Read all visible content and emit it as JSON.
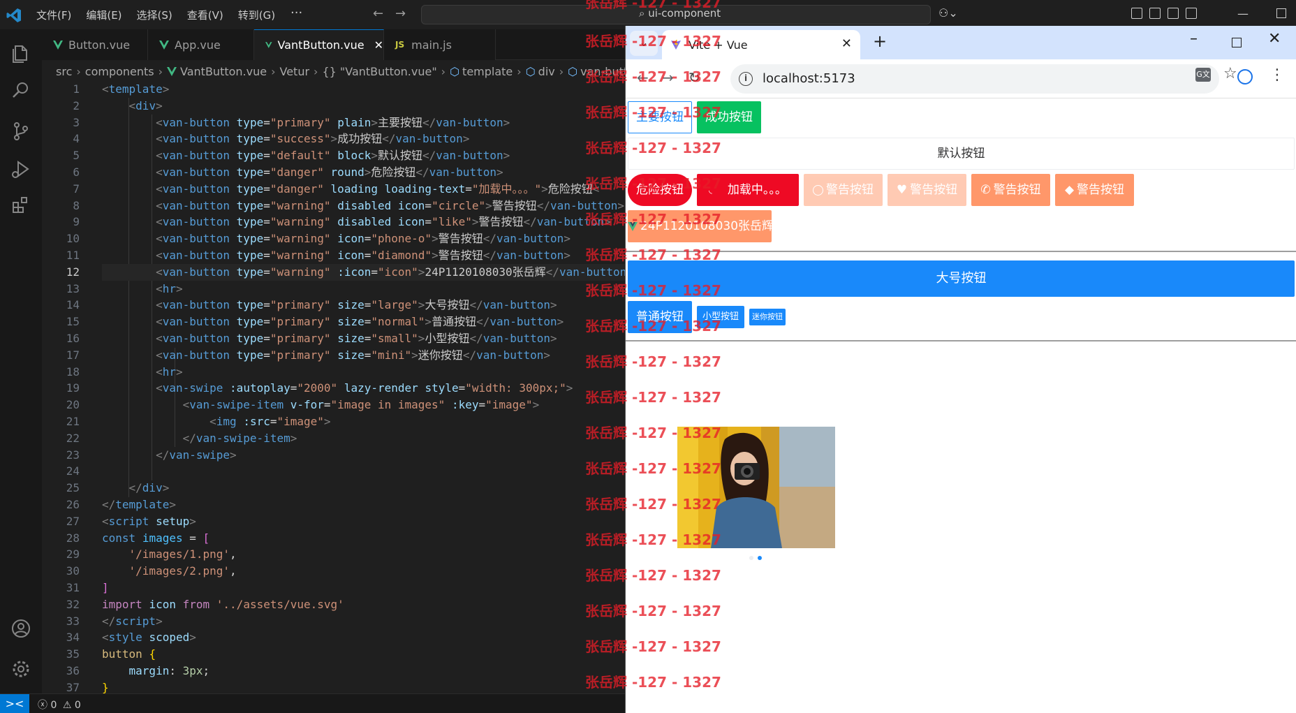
{
  "titlebar": {
    "menu": [
      "文件(F)",
      "编辑(E)",
      "选择(S)",
      "查看(V)",
      "转到(G)"
    ],
    "more": "···",
    "search_text": "ui-component"
  },
  "tabs": [
    {
      "label": "Button.vue",
      "icon": "vue-icon"
    },
    {
      "label": "App.vue",
      "icon": "vue-icon"
    },
    {
      "label": "VantButton.vue",
      "icon": "vue-icon"
    },
    {
      "label": "main.js",
      "icon": "js-icon",
      "prefix": "JS"
    }
  ],
  "breadcrumb": [
    "src",
    "components",
    "VantButton.vue",
    "Vetur",
    "{} \"VantButton.vue\"",
    "template",
    "div",
    "van-button"
  ],
  "editor": {
    "current_line": 12,
    "line_numbers": [
      "1",
      "2",
      "3",
      "4",
      "5",
      "6",
      "7",
      "8",
      "9",
      "10",
      "11",
      "12",
      "13",
      "14",
      "15",
      "16",
      "17",
      "18",
      "19",
      "20",
      "21",
      "22",
      "23",
      "24",
      "25",
      "26",
      "27",
      "28",
      "29",
      "30",
      "31",
      "32",
      "33",
      "34",
      "35",
      "36",
      "37"
    ]
  },
  "statusbar": {
    "remote": "><",
    "errors": "0",
    "warnings": "0"
  },
  "browser": {
    "tab_title": "Vite + Vue",
    "url": "localhost:5173",
    "translate": "G文"
  },
  "page": {
    "btn_primary_plain": "主要按钮",
    "btn_success": "成功按钮",
    "btn_default_block": "默认按钮",
    "btn_danger_round": "危险按钮",
    "btn_loading": "加载中。。。",
    "btn_warning_circle": "警告按钮",
    "btn_warning_like": "警告按钮",
    "btn_warning_phone": "警告按钮",
    "btn_warning_diamond": "警告按钮",
    "btn_warning_custom": "24P1120108030张岳辉",
    "btn_large": "大号按钮",
    "btn_normal": "普通按钮",
    "btn_small": "小型按钮",
    "btn_mini": "迷你按钮",
    "swipe_active_index": 2
  },
  "watermark": "张岳辉 -127 - 1327",
  "colors": {
    "primary": "#1989fa",
    "success": "#07c160",
    "danger": "#ee0a24",
    "warning": "#ff976a",
    "watermark": "#e61e28",
    "editor_bg": "#1f1f1f"
  }
}
